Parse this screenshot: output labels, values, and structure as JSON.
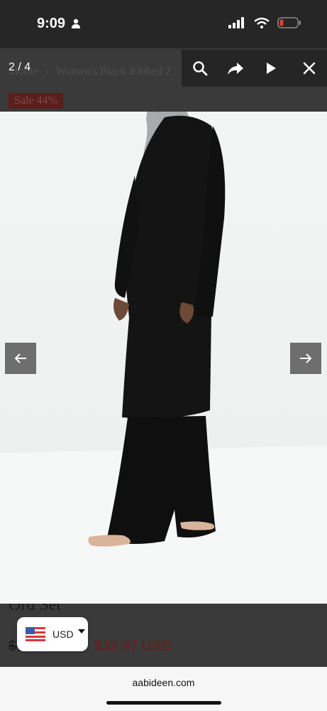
{
  "status_bar": {
    "time": "9:09"
  },
  "page": {
    "breadcrumb": [
      "Home",
      "Women's Black Ribbed 2"
    ],
    "sale_badge": "Sale 44%",
    "title_fragment": "Ord Set",
    "old_price": "$72.00 USD",
    "new_price": "$39.97 USD"
  },
  "viewer": {
    "counter": "2 / 4",
    "toolbar": [
      "search-icon",
      "share-icon",
      "play-icon",
      "close-icon"
    ],
    "prev_icon": "arrow-left-icon",
    "next_icon": "arrow-right-icon"
  },
  "currency": {
    "code": "USD",
    "flag": "us-flag-icon"
  },
  "browser": {
    "url": "aabideen.com"
  },
  "colors": {
    "sale_price": "#b03a3a",
    "overlay": "#262626",
    "garment": "#111111"
  }
}
